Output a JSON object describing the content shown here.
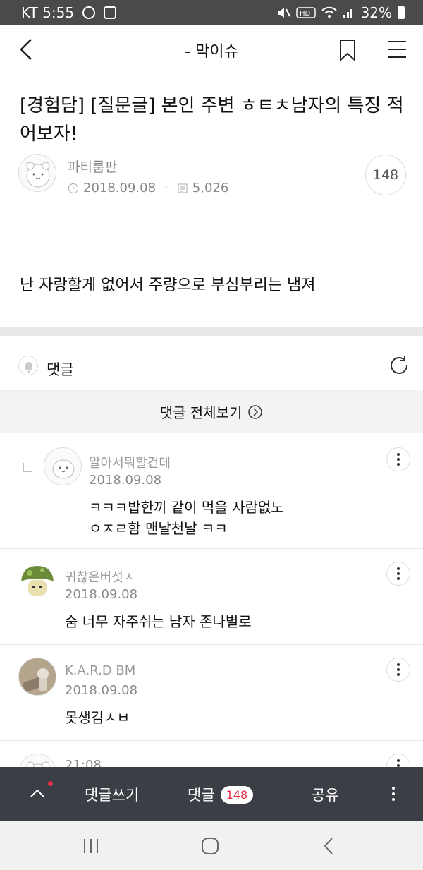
{
  "status_bar": {
    "carrier_time": "KT 5:55",
    "battery": "32%"
  },
  "header": {
    "title": "- 막이슈",
    "icons": [
      "back-icon",
      "bookmark-icon",
      "menu-icon"
    ]
  },
  "post": {
    "title": "[경험담] [질문글] 본인 주변 ㅎㅌㅊ남자의 특징 적어보자!",
    "author": "파티룸판",
    "date": "2018.09.08",
    "views": "5,026",
    "comment_count": "148",
    "body": "난 자랑할게 없어서 주량으로 부심부리는 냄져"
  },
  "comments_section": {
    "label": "댓글",
    "view_all": "댓글 전체보기"
  },
  "comments": [
    {
      "name": "알아서뭐할건데",
      "date": "2018.09.08",
      "text": "ㅋㅋㅋ밥한끼 같이 먹을 사람없노\nㅇㅈㄹ함 맨날천날 ㅋㅋ",
      "is_reply": true
    },
    {
      "name": "귀찮은버섯ㅅ",
      "date": "2018.09.08",
      "text": "숨 너무 자주쉬는 남자 존나별로",
      "is_reply": false
    },
    {
      "name": "K.A.R.D BM",
      "date": "2018.09.08",
      "text": "못생김ㅅㅂ",
      "is_reply": false
    },
    {
      "name": "",
      "date": "21:08",
      "text": "",
      "is_reply": false
    }
  ],
  "bottom_bar": {
    "write": "댓글쓰기",
    "comments": "댓글",
    "badge": "148",
    "share": "공유"
  },
  "colors": {
    "accent_red": "#e8304a",
    "bottom_bar_bg": "#3b3e44",
    "status_bar_bg": "#4a4a4a"
  }
}
